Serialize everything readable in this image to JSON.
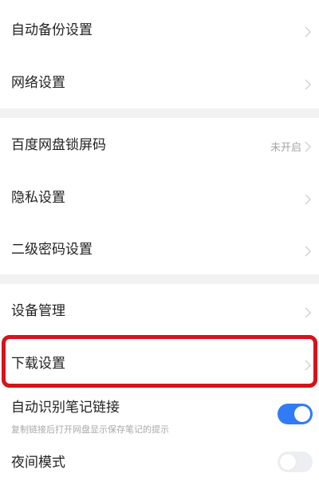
{
  "settings": {
    "auto_backup": "自动备份设置",
    "network": "网络设置",
    "screen_lock": "百度网盘锁屏码",
    "screen_lock_status": "未开启",
    "privacy": "隐私设置",
    "secondary_password": "二级密码设置",
    "device_management": "设备管理",
    "download_settings": "下载设置",
    "auto_detect_note_links": "自动识别笔记链接",
    "auto_detect_note_links_hint": "复制链接后打开网盘显示保存笔记的提示",
    "night_mode": "夜间模式"
  },
  "switches": {
    "auto_detect_note_links": "on",
    "night_mode": "off"
  },
  "colors": {
    "background": "#f2f2f3",
    "panel": "#ffffff",
    "accent": "#2f7cf6",
    "highlight": "#d6131d",
    "muted_text": "#a5a5a5"
  }
}
